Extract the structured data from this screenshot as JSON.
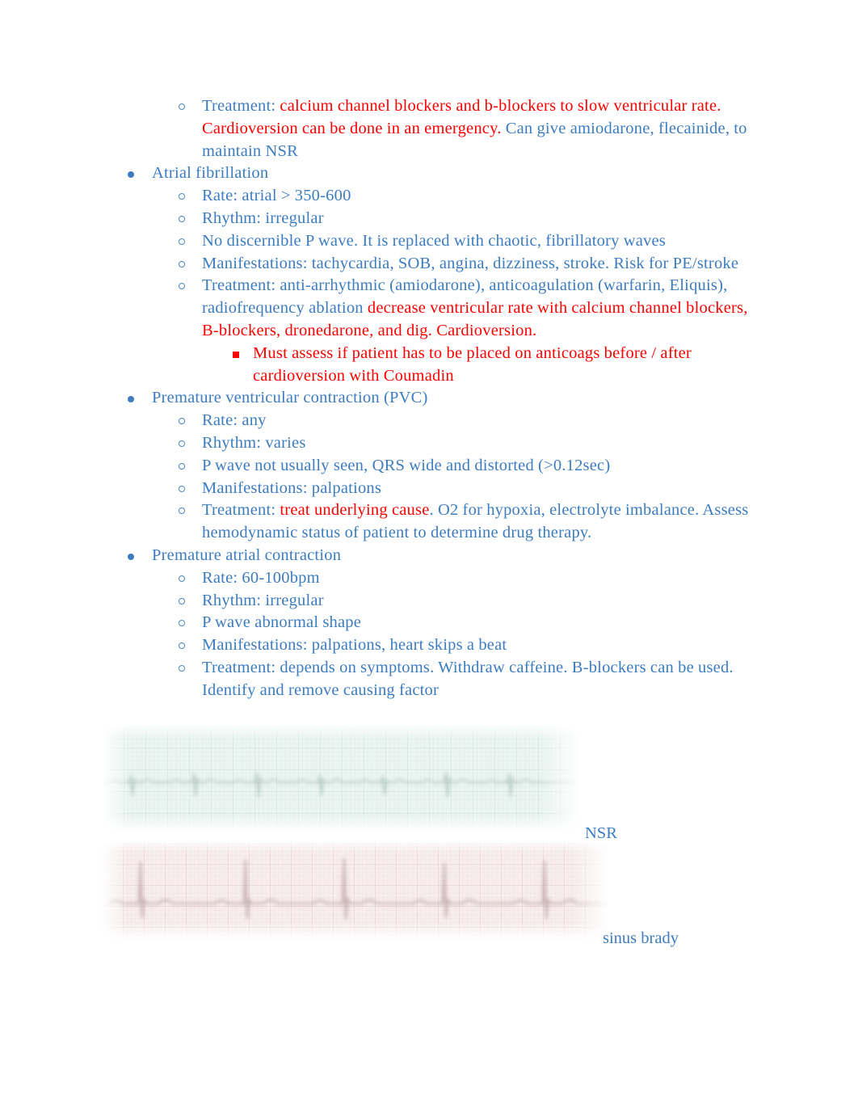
{
  "document": {
    "title": "Cardiac Dysrhythmias Notes",
    "text_color_blue": "#3c7cbf",
    "text_color_red": "#ff0000"
  },
  "outline": [
    {
      "level": 2,
      "bullet": "hollow-circle",
      "runs": [
        {
          "text": "Treatment: ",
          "color": "blue"
        },
        {
          "text": "calcium channel blockers and b-blockers to slow ventricular rate. Cardioversion can be done in an emergency.",
          "color": "red"
        },
        {
          "text": " Can give amiodarone, flecainide, to maintain NSR",
          "color": "blue"
        }
      ]
    },
    {
      "level": 1,
      "bullet": "filled-disc",
      "runs": [
        {
          "text": "Atrial fibrillation",
          "color": "blue"
        }
      ]
    },
    {
      "level": 2,
      "bullet": "hollow-circle",
      "runs": [
        {
          "text": "Rate: atrial > 350-600",
          "color": "blue"
        }
      ]
    },
    {
      "level": 2,
      "bullet": "hollow-circle",
      "runs": [
        {
          "text": "Rhythm: irregular",
          "color": "blue"
        }
      ]
    },
    {
      "level": 2,
      "bullet": "hollow-circle",
      "runs": [
        {
          "text": "No discernible P wave. It is replaced with chaotic, fibrillatory waves",
          "color": "blue"
        }
      ]
    },
    {
      "level": 2,
      "bullet": "hollow-circle",
      "runs": [
        {
          "text": "Manifestations: tachycardia, SOB, angina, dizziness, stroke. Risk for PE/stroke",
          "color": "blue"
        }
      ]
    },
    {
      "level": 2,
      "bullet": "hollow-circle",
      "runs": [
        {
          "text": "Treatment: anti-arrhythmic (amiodarone), anticoagulation (warfarin, Eliquis), radiofrequency ablation ",
          "color": "blue"
        },
        {
          "text": "decrease ventricular rate with calcium channel blockers, B-blockers, dronedarone, and dig. Cardioversion.",
          "color": "red"
        }
      ]
    },
    {
      "level": 3,
      "bullet": "filled-square",
      "runs": [
        {
          "text": "Must assess if patient has to be placed on anticoags before / after cardioversion with Coumadin",
          "color": "red"
        }
      ]
    },
    {
      "level": 1,
      "bullet": "filled-disc",
      "runs": [
        {
          "text": "Premature ventricular contraction (PVC)",
          "color": "blue"
        }
      ]
    },
    {
      "level": 2,
      "bullet": "hollow-circle",
      "runs": [
        {
          "text": "Rate: any",
          "color": "blue"
        }
      ]
    },
    {
      "level": 2,
      "bullet": "hollow-circle",
      "runs": [
        {
          "text": "Rhythm: varies",
          "color": "blue"
        }
      ]
    },
    {
      "level": 2,
      "bullet": "hollow-circle",
      "runs": [
        {
          "text": "P wave not usually seen, QRS wide and distorted (>0.12sec)",
          "color": "blue"
        }
      ]
    },
    {
      "level": 2,
      "bullet": "hollow-circle",
      "runs": [
        {
          "text": "Manifestations: palpations",
          "color": "blue"
        }
      ]
    },
    {
      "level": 2,
      "bullet": "hollow-circle",
      "runs": [
        {
          "text": "Treatment: ",
          "color": "blue"
        },
        {
          "text": "treat underlying cause",
          "color": "red"
        },
        {
          "text": ". O2 for hypoxia, electrolyte imbalance. Assess hemodynamic status of patient to determine drug therapy.",
          "color": "blue"
        }
      ]
    },
    {
      "level": 1,
      "bullet": "filled-disc",
      "runs": [
        {
          "text": "Premature atrial contraction",
          "color": "blue"
        }
      ]
    },
    {
      "level": 2,
      "bullet": "hollow-circle",
      "runs": [
        {
          "text": "Rate: 60-100bpm",
          "color": "blue"
        }
      ]
    },
    {
      "level": 2,
      "bullet": "hollow-circle",
      "runs": [
        {
          "text": "Rhythm: irregular",
          "color": "blue"
        }
      ]
    },
    {
      "level": 2,
      "bullet": "hollow-circle",
      "runs": [
        {
          "text": "P wave abnormal shape",
          "color": "blue"
        }
      ]
    },
    {
      "level": 2,
      "bullet": "hollow-circle",
      "runs": [
        {
          "text": "Manifestations: palpations, heart skips a beat",
          "color": "blue"
        }
      ]
    },
    {
      "level": 2,
      "bullet": "hollow-circle",
      "runs": [
        {
          "text": "Treatment: depends on symptoms. Withdraw caffeine. B-blockers can be used. Identify and remove causing factor",
          "color": "blue"
        }
      ]
    }
  ],
  "figures": [
    {
      "name": "ecg-strip-nsr",
      "caption": "NSR",
      "description": "faded ECG rhythm strip, pale green-tinted grid paper, normal sinus rhythm, 7 regularly spaced QRS complexes",
      "grid_tint": "#e8f3f0",
      "trace_color": "#9db5ac",
      "beats": 7
    },
    {
      "name": "ecg-strip-sinus-brady",
      "caption": "sinus brady",
      "description": "faded ECG rhythm strip, pale pink-tinted grid paper, sinus bradycardia, 5 widely spaced QRS complexes",
      "grid_tint": "#f6ecec",
      "trace_color": "#b79c9c",
      "beats": 5
    }
  ]
}
